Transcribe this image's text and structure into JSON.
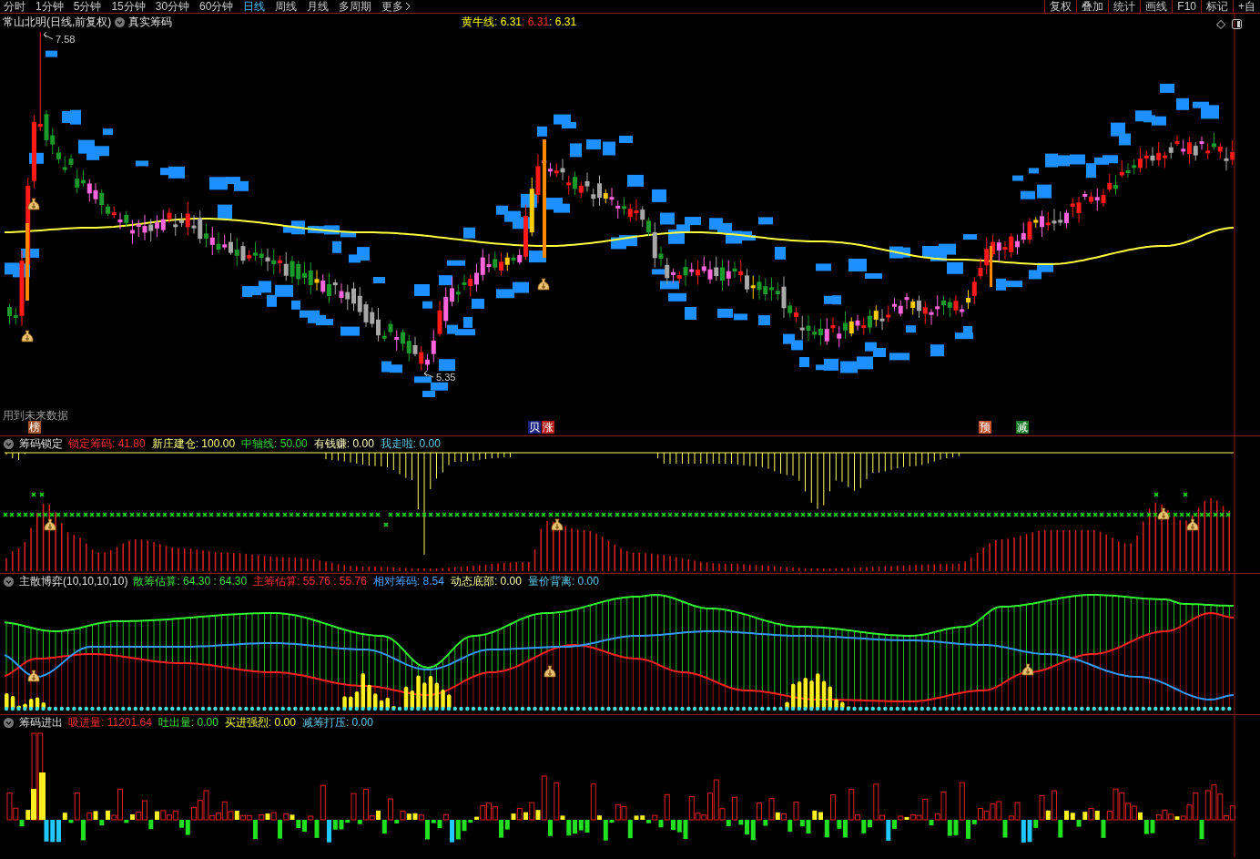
{
  "toolbar": {
    "periods": [
      {
        "label": "分时",
        "selected": false
      },
      {
        "label": "1分钟",
        "selected": false
      },
      {
        "label": "5分钟",
        "selected": false
      },
      {
        "label": "15分钟",
        "selected": false
      },
      {
        "label": "30分钟",
        "selected": false
      },
      {
        "label": "60分钟",
        "selected": false
      },
      {
        "label": "日线",
        "selected": true
      },
      {
        "label": "周线",
        "selected": false
      },
      {
        "label": "月线",
        "selected": false
      },
      {
        "label": "多周期",
        "selected": false
      },
      {
        "label": "更多",
        "selected": false
      }
    ],
    "tools": [
      "复权",
      "叠加",
      "统计",
      "画线",
      "F10",
      "标记",
      "+自"
    ]
  },
  "main_panel": {
    "title": "常山北明(日线,前复权)",
    "indicator": "真实筹码",
    "legend": [
      {
        "text": "黄牛线: 6.31",
        "color": "#ffff00"
      },
      {
        "text": ": 6.31",
        "color": "#ff3030"
      },
      {
        "text": ": 6.31",
        "color": "#ffff00"
      }
    ],
    "high_label": "7.58",
    "low_label": "5.35",
    "note": "用到未来数据",
    "signals": [
      {
        "text": "榜",
        "color": "#a0522d"
      },
      {
        "text": "贝",
        "color": "#1a237e"
      },
      {
        "text": "涨",
        "color": "#b71c1c"
      },
      {
        "text": "预",
        "color": "#c0502a"
      },
      {
        "text": "减",
        "color": "#1b7a2a"
      }
    ]
  },
  "panels": [
    {
      "name": "筹码锁定",
      "legend": [
        {
          "text": "锁定筹码: 41.80",
          "color": "#ff3030"
        },
        {
          "text": "新庄建仓: 100.00",
          "color": "#ffff80"
        },
        {
          "text": "中轴线: 50.00",
          "color": "#30d030"
        },
        {
          "text": "有钱赚: 0.00",
          "color": "#ffffc0"
        },
        {
          "text": "我走啦: 0.00",
          "color": "#60c8e8"
        }
      ]
    },
    {
      "name": "主散博弈(10,10,10,10)",
      "legend": [
        {
          "text": "散筹估算: 64.30 : 64.30",
          "color": "#40e040"
        },
        {
          "text": "主筹估算: 55.76 : 55.76",
          "color": "#ff3030"
        },
        {
          "text": "相对筹码: 8.54",
          "color": "#4da6ff"
        },
        {
          "text": "动态底部: 0.00",
          "color": "#ffffa0"
        },
        {
          "text": "量价背离: 0.00",
          "color": "#60c8e8"
        }
      ]
    },
    {
      "name": "筹码进出",
      "legend": [
        {
          "text": "吸进量: 11201.64",
          "color": "#ff3030"
        },
        {
          "text": "吐出量: 0.00",
          "color": "#40e040"
        },
        {
          "text": "买进强烈: 0.00",
          "color": "#ffff40"
        },
        {
          "text": "减筹打压: 0.00",
          "color": "#60c8e8"
        }
      ]
    }
  ]
}
